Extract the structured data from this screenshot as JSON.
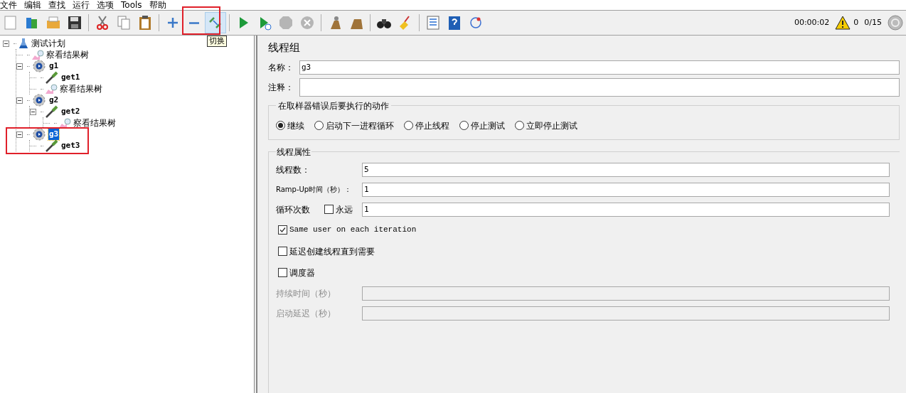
{
  "menu": [
    "文件",
    "编辑",
    "查找",
    "运行",
    "选项",
    "Tools",
    "帮助"
  ],
  "toolbar": [
    [
      {
        "kind": "new",
        "highlighted": false,
        "disabled": false
      },
      {
        "kind": "templates",
        "highlighted": false,
        "disabled": false
      },
      {
        "kind": "open",
        "highlighted": false,
        "disabled": false
      },
      {
        "kind": "save",
        "highlighted": false,
        "disabled": false
      }
    ],
    [
      {
        "kind": "cut",
        "highlighted": false,
        "disabled": false
      },
      {
        "kind": "copy",
        "highlighted": false,
        "disabled": false
      },
      {
        "kind": "paste",
        "highlighted": false,
        "disabled": false
      }
    ],
    [
      {
        "kind": "expand",
        "highlighted": false,
        "disabled": false
      },
      {
        "kind": "collapse",
        "highlighted": false,
        "disabled": false
      },
      {
        "kind": "toggle",
        "highlighted": true,
        "disabled": false
      }
    ],
    [
      {
        "kind": "start",
        "highlighted": false,
        "disabled": false
      },
      {
        "kind": "start-no-pause",
        "highlighted": false,
        "disabled": false
      },
      {
        "kind": "stop",
        "highlighted": false,
        "disabled": true
      },
      {
        "kind": "shutdown",
        "highlighted": false,
        "disabled": true
      }
    ],
    [
      {
        "kind": "clear",
        "highlighted": false,
        "disabled": false
      },
      {
        "kind": "clear-all",
        "highlighted": false,
        "disabled": false
      }
    ],
    [
      {
        "kind": "search",
        "highlighted": false,
        "disabled": false
      },
      {
        "kind": "reset",
        "highlighted": false,
        "disabled": false
      }
    ],
    [
      {
        "kind": "list",
        "highlighted": false,
        "disabled": false
      },
      {
        "kind": "help",
        "highlighted": false,
        "disabled": false
      },
      {
        "kind": "remote",
        "highlighted": false,
        "disabled": false
      }
    ]
  ],
  "tooltip": "切换",
  "status": {
    "timer": "00:00:02",
    "warnings": "0",
    "threads": "0/15"
  },
  "tree": [
    {
      "label": "测试计划",
      "kind": "plan",
      "expanded": true,
      "selected": false,
      "children": [
        {
          "label": "察看结果树",
          "kind": "listener",
          "selected": false
        },
        {
          "label": "g1",
          "kind": "group",
          "expanded": true,
          "selected": false,
          "children": [
            {
              "label": "get1",
              "kind": "sampler",
              "selected": false
            },
            {
              "label": "察看结果树",
              "kind": "listener",
              "selected": false
            }
          ]
        },
        {
          "label": "g2",
          "kind": "group",
          "expanded": true,
          "selected": false,
          "children": [
            {
              "label": "get2",
              "kind": "sampler",
              "expanded": true,
              "selected": false,
              "children": [
                {
                  "label": "察看结果树",
                  "kind": "listener",
                  "selected": false
                }
              ]
            }
          ]
        },
        {
          "label": "g3",
          "kind": "group",
          "expanded": true,
          "selected": true,
          "children": [
            {
              "label": "get3",
              "kind": "sampler",
              "selected": false
            }
          ]
        }
      ]
    }
  ],
  "panel": {
    "title": "线程组",
    "name": {
      "label": "名称：",
      "value": "g3"
    },
    "comment": {
      "label": "注释："
    },
    "on_error": {
      "title": "在取样器错误后要执行的动作",
      "options": [
        {
          "label": "继续",
          "selected": true
        },
        {
          "label": "启动下一进程循环",
          "selected": false
        },
        {
          "label": "停止线程",
          "selected": false
        },
        {
          "label": "停止测试",
          "selected": false
        },
        {
          "label": "立即停止测试",
          "selected": false
        }
      ]
    },
    "thread_props": {
      "title": "线程属性",
      "threads": {
        "label": "线程数：",
        "value": "5"
      },
      "ramp_up": {
        "label": "Ramp-Up时间（秒）：",
        "value": "1"
      },
      "loops": {
        "label": "循环次数",
        "forever_label": "永远",
        "forever_checked": false,
        "value": "1"
      },
      "checks": [
        {
          "label": "Same user on each iteration",
          "checked": true
        },
        {
          "label": "延迟创建线程直到需要",
          "checked": false
        },
        {
          "label": "调度器",
          "checked": false
        }
      ],
      "duration": {
        "label": "持续时间（秒）",
        "disabled": true
      },
      "startup_delay": {
        "label": "启动延迟（秒）",
        "disabled": true
      }
    }
  }
}
